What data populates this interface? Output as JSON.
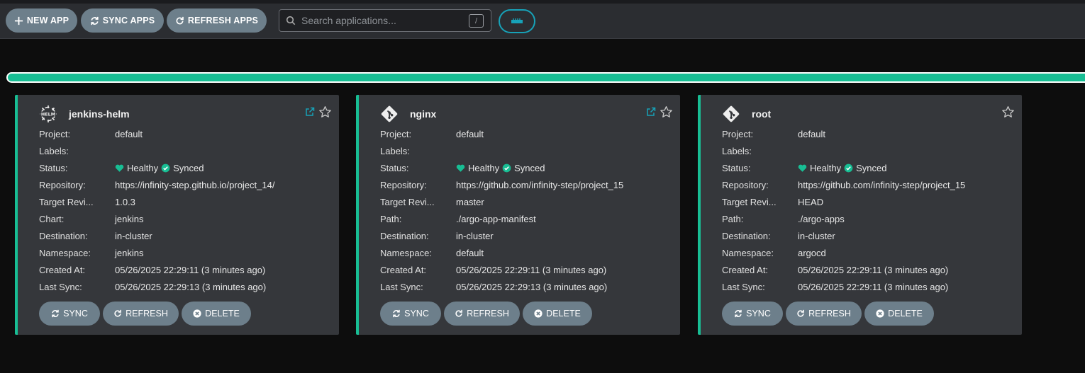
{
  "toolbar": {
    "new_app": "NEW APP",
    "sync_apps": "SYNC APPS",
    "refresh_apps": "REFRESH APPS",
    "search_placeholder": "Search applications...",
    "search_shortcut": "/"
  },
  "colors": {
    "healthy": "#18be94",
    "button": "#6d7f8b",
    "accent": "#17a2b8",
    "card": "#35373b"
  },
  "health_progress": 1.0,
  "labels": {
    "project": "Project:",
    "labels": "Labels:",
    "status": "Status:",
    "repository": "Repository:",
    "target_revision": "Target Revi...",
    "chart": "Chart:",
    "path": "Path:",
    "destination": "Destination:",
    "namespace": "Namespace:",
    "created_at": "Created At:",
    "last_sync": "Last Sync:"
  },
  "card_actions": {
    "sync": "SYNC",
    "refresh": "REFRESH",
    "delete": "DELETE"
  },
  "apps": [
    {
      "name": "jenkins-helm",
      "icon": "helm-icon",
      "project": "default",
      "labels": "",
      "health": "Healthy",
      "sync": "Synced",
      "repository": "https://infinity-step.github.io/project_14/",
      "target_revision": "1.0.3",
      "source_label": "Chart:",
      "source": "jenkins",
      "destination": "in-cluster",
      "namespace": "jenkins",
      "created_at": "05/26/2025 22:29:11  (3 minutes ago)",
      "last_sync": "05/26/2025 22:29:13  (3 minutes ago)"
    },
    {
      "name": "nginx",
      "icon": "git-icon",
      "project": "default",
      "labels": "",
      "health": "Healthy",
      "sync": "Synced",
      "repository": "https://github.com/infinity-step/project_15",
      "target_revision": "master",
      "source_label": "Path:",
      "source": "./argo-app-manifest",
      "destination": "in-cluster",
      "namespace": "default",
      "created_at": "05/26/2025 22:29:11  (3 minutes ago)",
      "last_sync": "05/26/2025 22:29:13  (3 minutes ago)"
    },
    {
      "name": "root",
      "icon": "git-icon",
      "project": "default",
      "labels": "",
      "health": "Healthy",
      "sync": "Synced",
      "repository": "https://github.com/infinity-step/project_15",
      "target_revision": "HEAD",
      "source_label": "Path:",
      "source": "./argo-apps",
      "destination": "in-cluster",
      "namespace": "argocd",
      "created_at": "05/26/2025 22:29:11  (3 minutes ago)",
      "last_sync": "05/26/2025 22:29:11  (3 minutes ago)"
    }
  ]
}
